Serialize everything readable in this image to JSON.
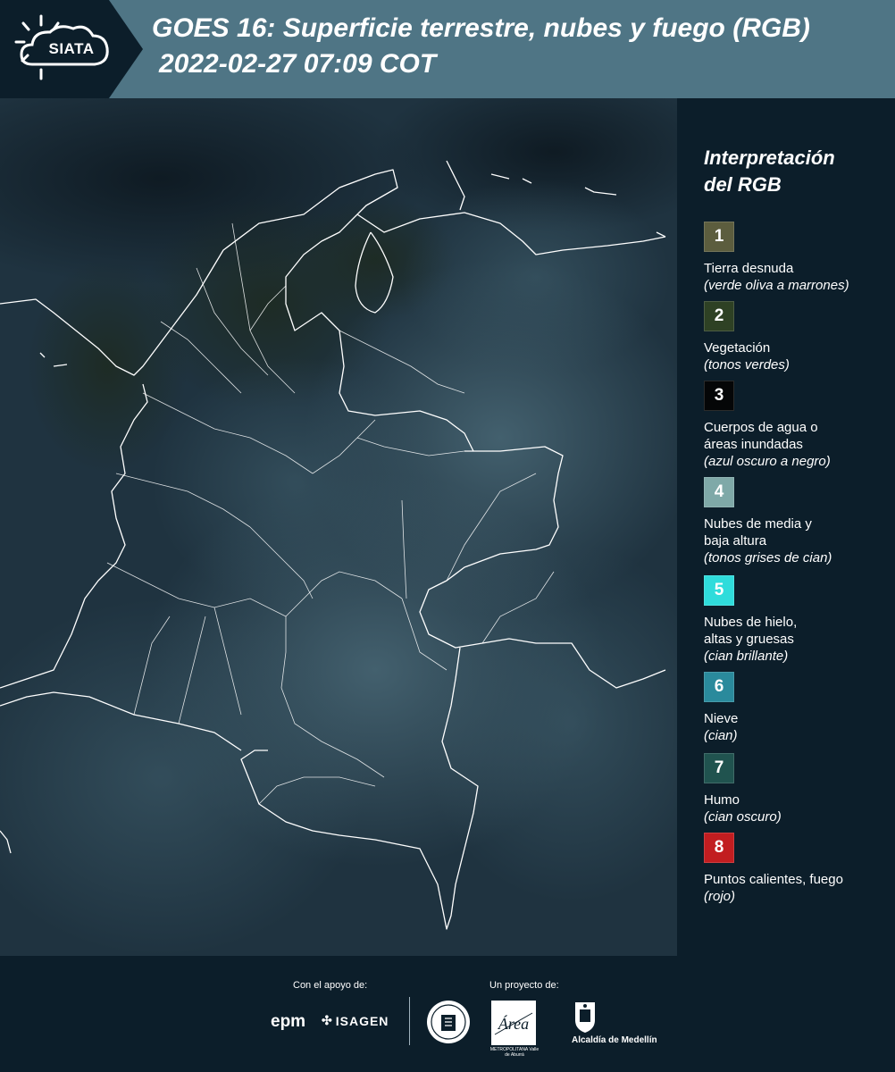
{
  "header": {
    "logo_text": "SIATA",
    "title": "GOES 16: Superficie terrestre, nubes y fuego (RGB)",
    "datetime": "2022-02-27 07:09 COT"
  },
  "legend": {
    "title_line1": "Interpretación",
    "title_line2": "del RGB",
    "items": [
      {
        "number": "1",
        "color": "#5c5d3e",
        "label_lines": [
          "Tierra desnuda"
        ],
        "note": "(verde oliva a marrones)"
      },
      {
        "number": "2",
        "color": "#2e4124",
        "label_lines": [
          "Vegetación"
        ],
        "note": "(tonos verdes)"
      },
      {
        "number": "3",
        "color": "#050607",
        "label_lines": [
          "Cuerpos de agua o",
          "áreas inundadas"
        ],
        "note": "(azul oscuro a negro)"
      },
      {
        "number": "4",
        "color": "#7fa9a8",
        "label_lines": [
          "Nubes de media y",
          "baja altura"
        ],
        "note": "(tonos grises de cian)"
      },
      {
        "number": "5",
        "color": "#2fdcdb",
        "label_lines": [
          "Nubes de hielo,",
          "altas y gruesas"
        ],
        "note": "(cian brillante)"
      },
      {
        "number": "6",
        "color": "#2a8a9c",
        "label_lines": [
          "Nieve"
        ],
        "note": "(cian)"
      },
      {
        "number": "7",
        "color": "#20534f",
        "label_lines": [
          "Humo"
        ],
        "note": "(cian oscuro)"
      },
      {
        "number": "8",
        "color": "#c21d20",
        "label_lines": [
          "Puntos calientes, fuego"
        ],
        "note": "(rojo)"
      }
    ]
  },
  "footer": {
    "support_label": "Con el apoyo de:",
    "project_label": "Un proyecto de:",
    "epm": "epm",
    "isagen": "ISAGEN",
    "area_name": "Área",
    "area_subtitle": "METROPOLITANA Valle de Aburrá",
    "alcaldia": "Alcaldía de Medellín"
  },
  "colors": {
    "header_bg": "#4f7585",
    "logo_panel_bg": "#0c1e2a",
    "page_bg": "#0c1e2a",
    "boundary_lines": "#ffffff"
  }
}
